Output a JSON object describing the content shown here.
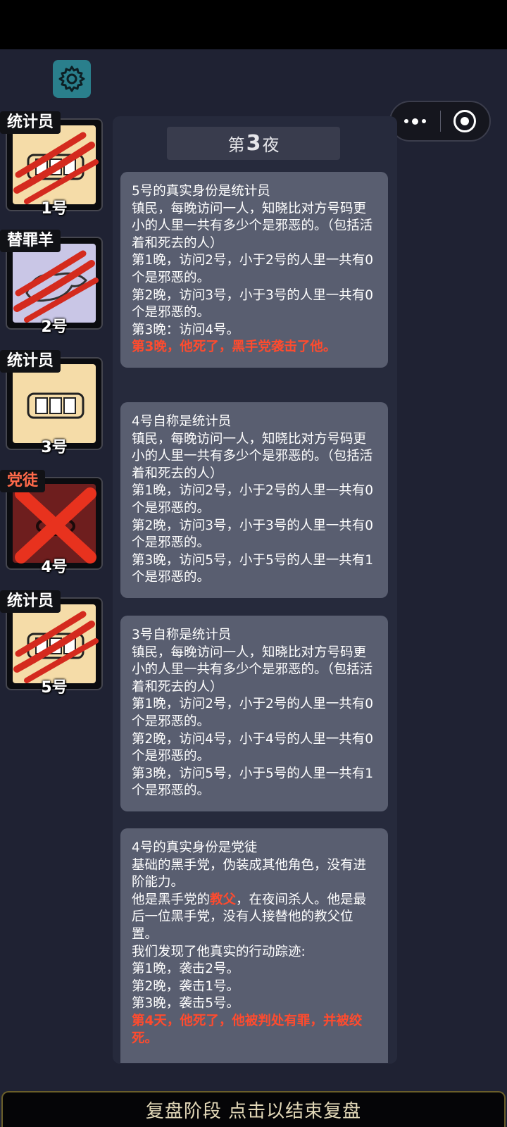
{
  "night": {
    "prefix": "第",
    "number": "3",
    "suffix": "夜"
  },
  "players": [
    {
      "role": "统计员",
      "number": "1号",
      "status": "claw"
    },
    {
      "role": "替罪羊",
      "number": "2号",
      "status": "claw"
    },
    {
      "role": "统计员",
      "number": "3号",
      "status": "alive"
    },
    {
      "role": "党徒",
      "number": "4号",
      "status": "executed"
    },
    {
      "role": "统计员",
      "number": "5号",
      "status": "claw"
    }
  ],
  "logs": [
    {
      "lines": [
        "5号的真实身份是统计员",
        "镇民，每晚访问一人，知晓比对方号码更小的人里一共有多少个是邪恶的。（包括活着和死去的人）",
        "第1晚，访问2号，小于2号的人里一共有0个是邪恶的。",
        "第2晚，访问3号，小于3号的人里一共有0个是邪恶的。",
        "第3晚：访问4号。"
      ],
      "red": "第3晚，他死了，黑手党袭击了他。"
    },
    {
      "lines": [
        "4号自称是统计员",
        "镇民，每晚访问一人，知晓比对方号码更小的人里一共有多少个是邪恶的。（包括活着和死去的人）",
        "第1晚，访问2号，小于2号的人里一共有0个是邪恶的。",
        "第2晚，访问3号，小于3号的人里一共有0个是邪恶的。",
        "第3晚，访问5号，小于5号的人里一共有1个是邪恶的。"
      ]
    },
    {
      "lines": [
        "3号自称是统计员",
        "镇民，每晚访问一人，知晓比对方号码更小的人里一共有多少个是邪恶的。（包括活着和死去的人）",
        "第1晚，访问2号，小于2号的人里一共有0个是邪恶的。",
        "第2晚，访问4号，小于4号的人里一共有0个是邪恶的。",
        "第3晚，访问5号，小于5号的人里一共有1个是邪恶的。"
      ]
    },
    {
      "lines": [
        "4号的真实身份是党徒",
        "基础的黑手党，伪装成其他角色，没有进阶能力。"
      ],
      "godfather_pre": "他是黑手党的",
      "godfather_word": "教父",
      "godfather_post": "，在夜间杀人。他是最后一位黑手党，没有人接替他的教父位置。",
      "lines2": [
        "我们发现了他真实的行动踪迹:",
        "第1晚，袭击2号。",
        "第2晚，袭击1号。",
        "第3晚，袭击5号。"
      ],
      "red": "第4天，他死了，他被判处有罪，并被绞死。"
    }
  ],
  "bottom_bar": "复盘阶段 点击以结束复盘",
  "colors": {
    "accent_red": "#ff4b2e",
    "settings_bg": "#2a7f8c",
    "card_beige": "#f5dca8"
  },
  "icons": {
    "settings": "gear-icon",
    "menu": "more-dots-icon",
    "close": "record-icon"
  }
}
